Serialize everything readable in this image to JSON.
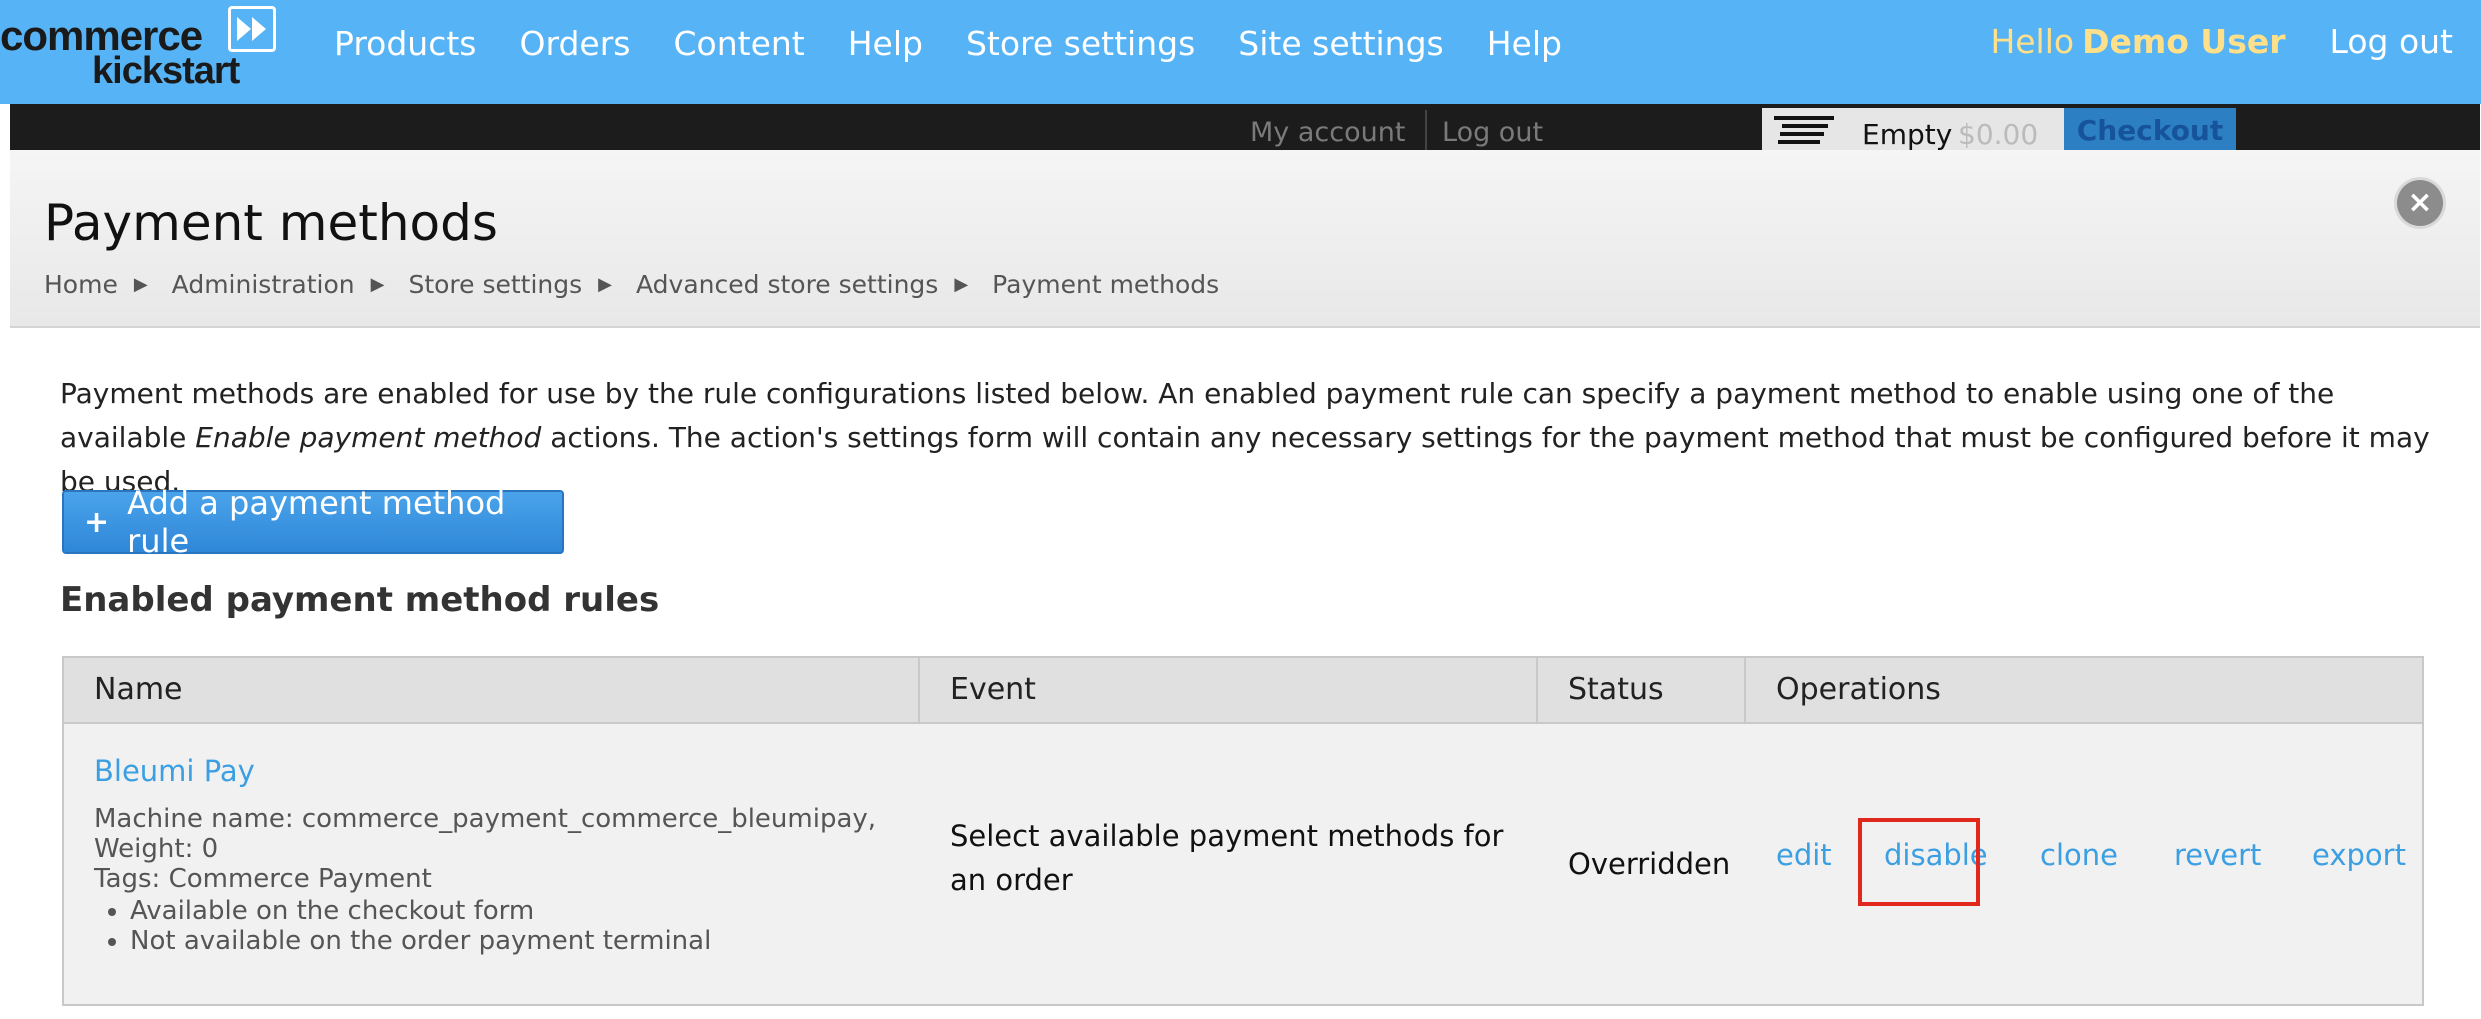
{
  "logo": {
    "word1": "commerce",
    "word2": "kickstart"
  },
  "nav": {
    "items": [
      "Products",
      "Orders",
      "Content",
      "Help",
      "Store settings",
      "Site settings",
      "Help"
    ]
  },
  "user": {
    "hello": "Hello",
    "name": "Demo User",
    "logout": "Log out"
  },
  "strip": {
    "my_account": "My account",
    "logout": "Log out",
    "cart_status": "Empty",
    "cart_total": "$0.00",
    "checkout": "Checkout"
  },
  "page": {
    "title": "Payment methods",
    "breadcrumb": [
      "Home",
      "Administration",
      "Store settings",
      "Advanced store settings",
      "Payment methods"
    ],
    "close_icon": "×"
  },
  "description": {
    "part1": "Payment methods are enabled for use by the rule configurations listed below. An enabled payment rule can specify a payment method to enable using one of the available ",
    "em": "Enable payment method",
    "part2": " actions. The action's settings form will contain any necessary settings for the payment method that must be configured before it may be used."
  },
  "add_button": {
    "icon": "+",
    "label": "Add a payment method rule"
  },
  "section_title": "Enabled payment method rules",
  "table": {
    "headers": [
      "Name",
      "Event",
      "Status",
      "Operations"
    ],
    "rows": [
      {
        "name": "Bleumi Pay",
        "machine_name": "Machine name: commerce_payment_commerce_bleumipay,",
        "weight": "Weight: 0",
        "tags": "Tags: Commerce Payment",
        "bullets": [
          "Available on the checkout form",
          "Not available on the order payment terminal"
        ],
        "event": "Select available payment methods for an order",
        "status": "Overridden",
        "operations": [
          "edit",
          "disable",
          "clone",
          "revert",
          "export"
        ]
      }
    ]
  },
  "colors": {
    "toolbar_bg": "#56b3f5",
    "link": "#3c9fe2",
    "highlight": "#e0281c",
    "hello_name": "#ffe08a"
  }
}
